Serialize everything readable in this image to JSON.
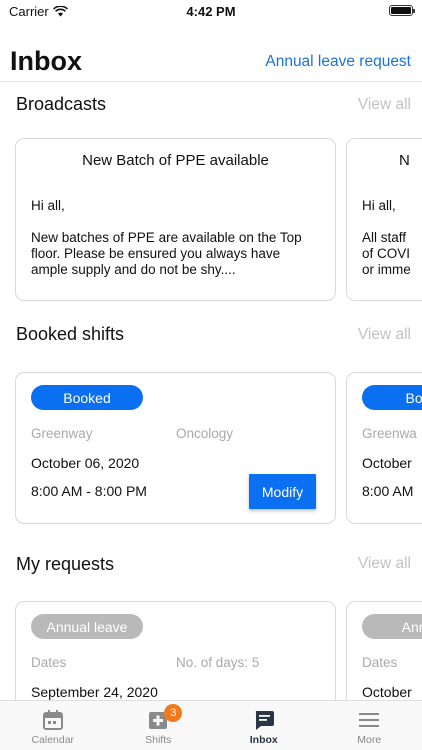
{
  "status_bar": {
    "carrier": "Carrier",
    "time": "4:42 PM"
  },
  "header": {
    "title": "Inbox",
    "action_label": "Annual leave request"
  },
  "broadcasts": {
    "title": "Broadcasts",
    "view_all": "View all",
    "cards": [
      {
        "title": "New Batch of PPE available",
        "greeting": "Hi all,",
        "body": "New batches of PPE are available on the Top floor. Please be ensured you always have ample supply and do not be shy...."
      },
      {
        "title": "N",
        "greeting": "Hi all,",
        "body": "All staff\nof COVI\nor imme"
      }
    ]
  },
  "booked_shifts": {
    "title": "Booked shifts",
    "view_all": "View all",
    "cards": [
      {
        "status": "Booked",
        "location": "Greenway",
        "department": "Oncology",
        "date": "October 06, 2020",
        "time": "8:00 AM - 8:00 PM",
        "action_label": "Modify"
      },
      {
        "status": "Boo",
        "location": "Greenwa",
        "date": "October",
        "time": "8:00 AM"
      }
    ]
  },
  "my_requests": {
    "title": "My requests",
    "view_all": "View all",
    "cards": [
      {
        "status": "Annual leave",
        "dates_label": "Dates",
        "days_label": "No. of days: 5",
        "date": "September 24, 2020"
      },
      {
        "status": "Annu",
        "dates_label": "Dates",
        "date": "October"
      }
    ]
  },
  "tab_bar": {
    "items": [
      {
        "label": "Calendar",
        "icon": "calendar-icon"
      },
      {
        "label": "Shifts",
        "icon": "medical-cross-icon",
        "badge": "3"
      },
      {
        "label": "Inbox",
        "icon": "chat-bubble-icon",
        "active": true
      },
      {
        "label": "More",
        "icon": "menu-icon"
      }
    ]
  },
  "colors": {
    "accent": "#0a6ff0",
    "link": "#1a73d9",
    "muted": "#b9b9b9",
    "badge": "#f07a1a"
  }
}
